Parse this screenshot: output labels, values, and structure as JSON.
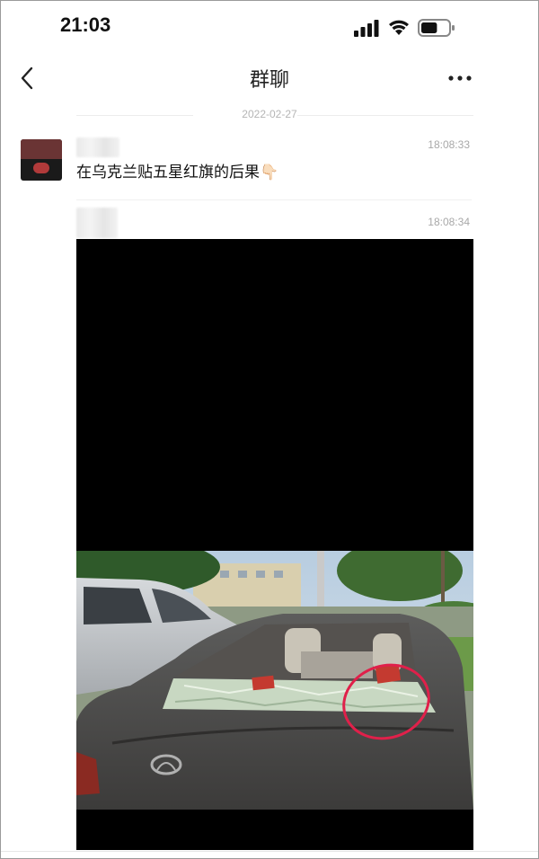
{
  "status_bar": {
    "time": "21:03",
    "signal_icon": "cellular-signal-icon",
    "wifi_icon": "wifi-icon",
    "battery_icon": "battery-icon",
    "battery_level": 0.6
  },
  "nav": {
    "back_icon": "chevron-left-icon",
    "title": "群聊",
    "more_icon": "ellipsis-icon"
  },
  "chat": {
    "date_separator": "2022-02-27",
    "messages": [
      {
        "time": "18:08:33",
        "text": "在乌克兰贴五星红旗的后果👇🏻",
        "type": "text"
      },
      {
        "time": "18:08:34",
        "type": "video"
      }
    ]
  },
  "colors": {
    "background": "#ffffff",
    "meta_text": "#a8a8a8",
    "annotation_circle": "#e0204a"
  }
}
